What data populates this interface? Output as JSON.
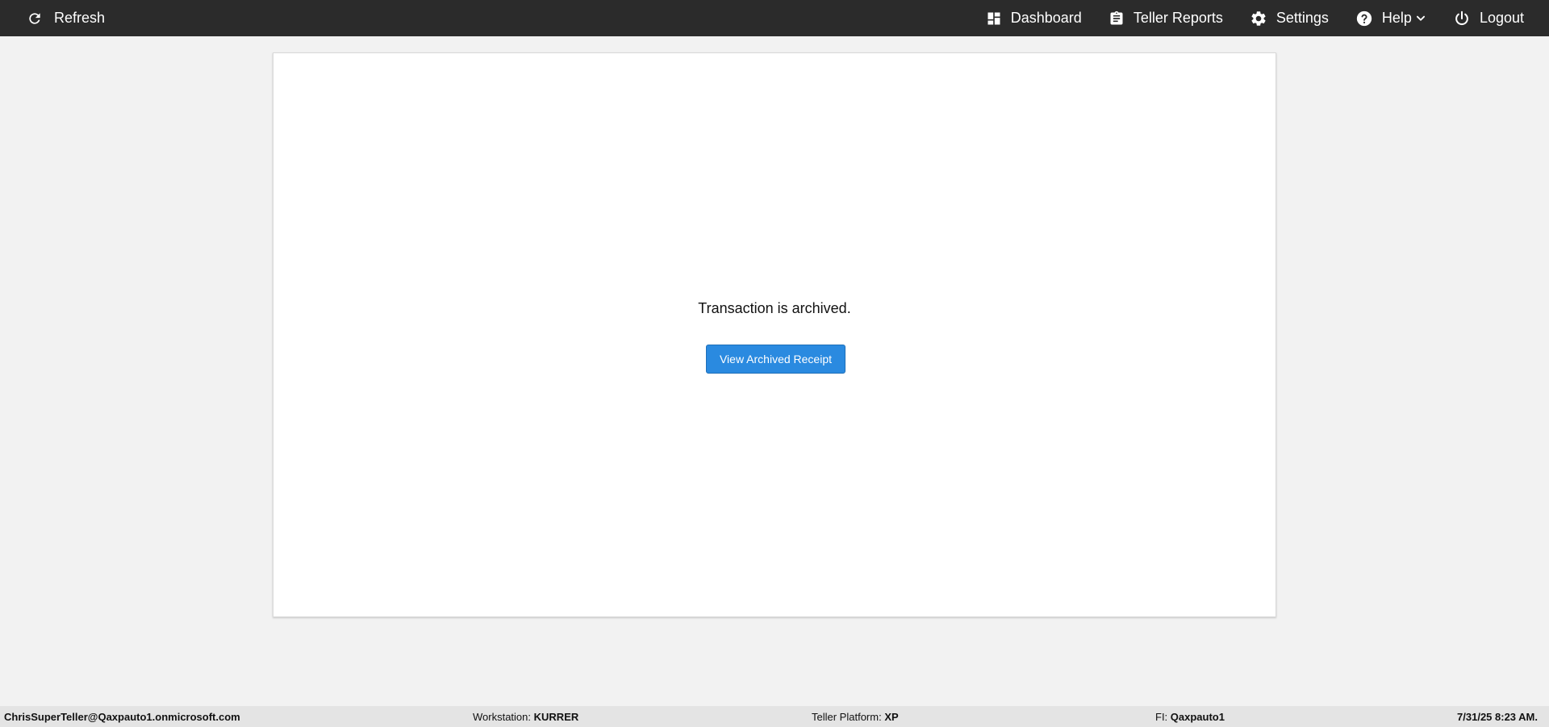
{
  "topbar": {
    "refresh_label": "Refresh",
    "nav": {
      "dashboard": "Dashboard",
      "teller_reports": "Teller Reports",
      "settings": "Settings",
      "help": "Help",
      "logout": "Logout"
    },
    "icons": [
      "refresh-icon",
      "dashboard-icon",
      "clipboard-icon",
      "gear-icon",
      "help-circle-icon",
      "chevron-down-icon",
      "power-icon"
    ]
  },
  "main": {
    "message": "Transaction is archived.",
    "button_label": "View Archived Receipt"
  },
  "footer": {
    "user": "ChrisSuperTeller@Qaxpauto1.onmicrosoft.com",
    "workstation_label": "Workstation:",
    "workstation_value": "KURRER",
    "platform_label": "Teller Platform:",
    "platform_value": "XP",
    "fi_label": "FI:",
    "fi_value": "Qaxpauto1",
    "datetime": "7/31/25 8:23 AM."
  },
  "colors": {
    "topbar_bg": "#2b2b2b",
    "page_bg": "#f2f2f2",
    "button_bg": "#2a8ae0"
  }
}
